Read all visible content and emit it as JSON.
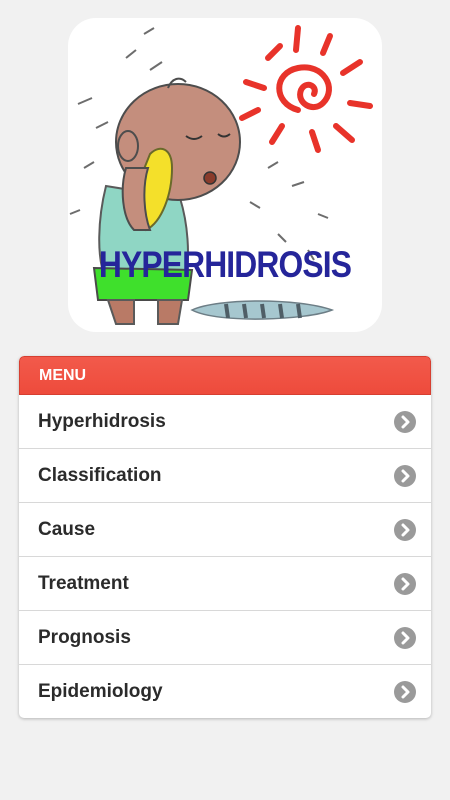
{
  "hero": {
    "title": "HYPERHIDROSIS",
    "icon": "sweating-child-illustration"
  },
  "menu": {
    "header": "MENU",
    "arrow_icon": "chevron-right-circle-icon",
    "items": [
      {
        "label": "Hyperhidrosis"
      },
      {
        "label": "Classification"
      },
      {
        "label": "Cause"
      },
      {
        "label": "Treatment"
      },
      {
        "label": "Prognosis"
      },
      {
        "label": "Epidemiology"
      }
    ]
  },
  "colors": {
    "background": "#f1f1f1",
    "header": "#ef4f40",
    "title_text": "#25259a",
    "arrow": "#9a9a9a"
  }
}
